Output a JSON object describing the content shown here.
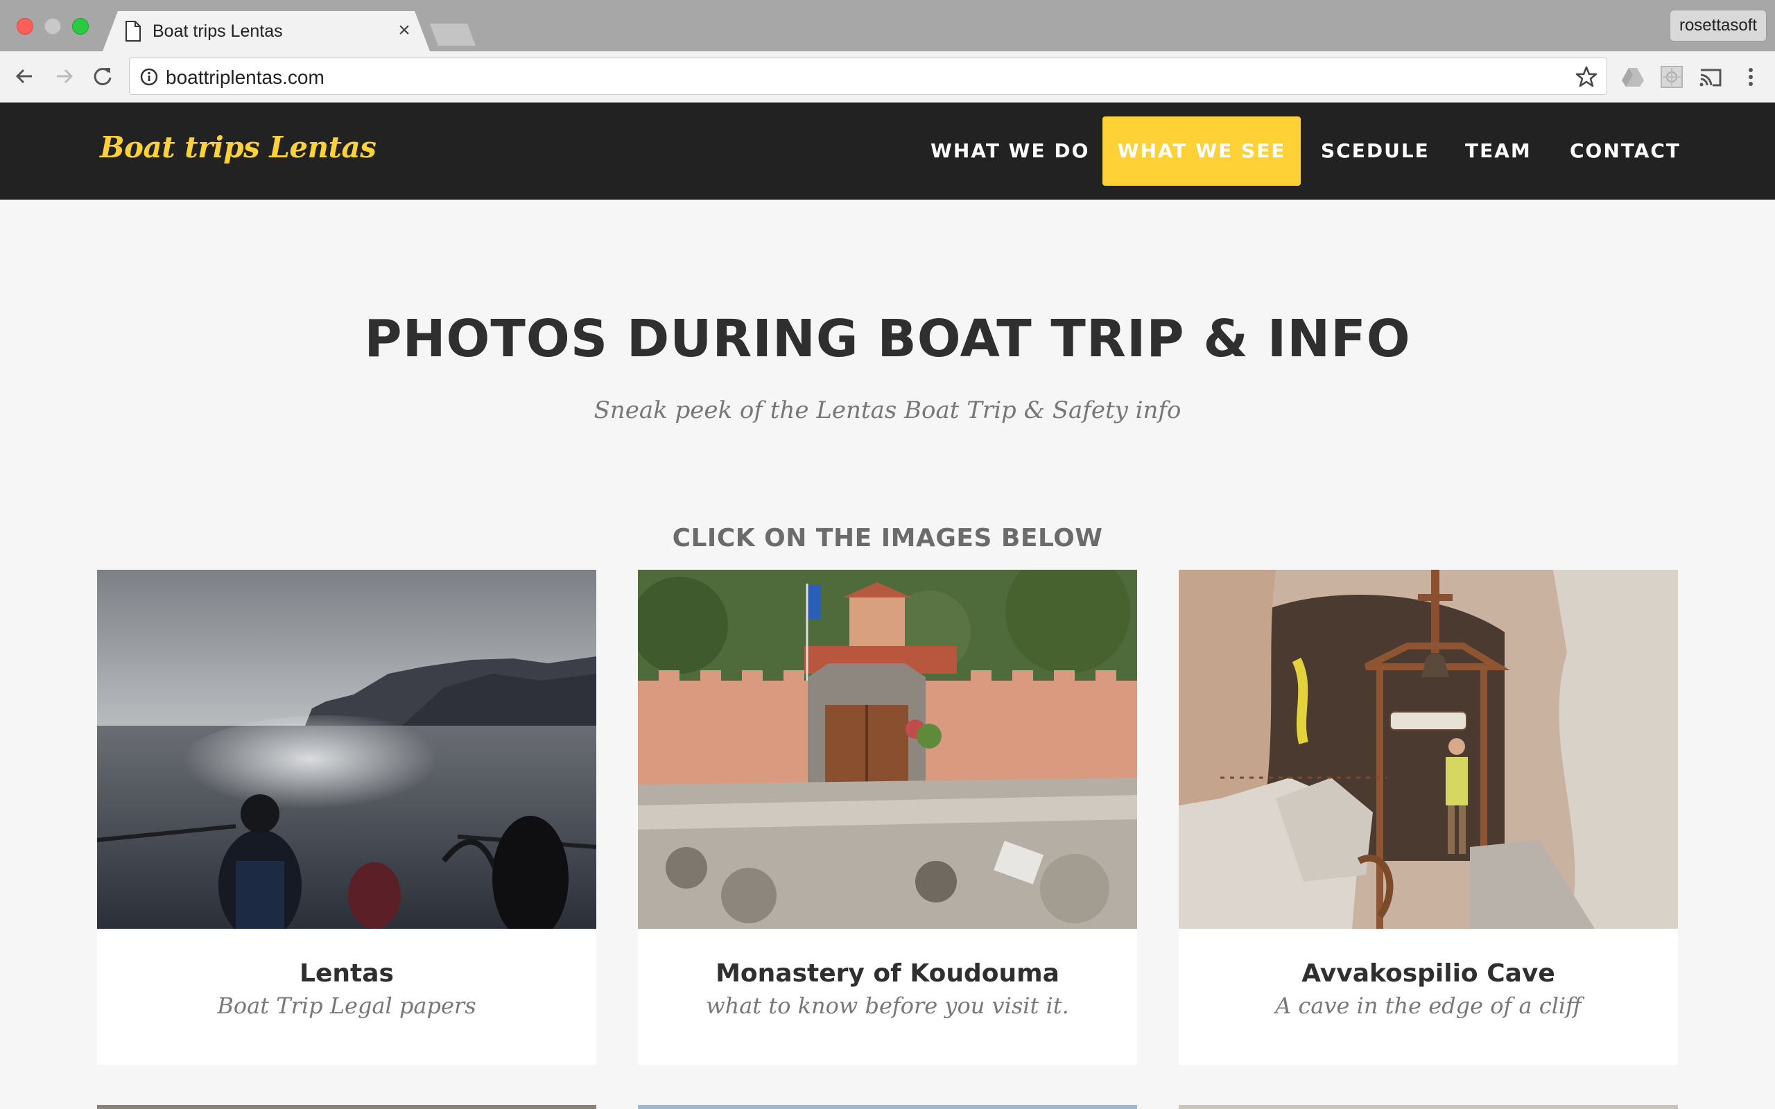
{
  "browser": {
    "tab_title": "Boat trips Lentas",
    "tab_close": "×",
    "url": "boattriplentas.com",
    "profile": "rosettasoft"
  },
  "site": {
    "brand": "Boat trips Lentas",
    "accent_color": "#fed136",
    "nav": [
      {
        "label": "WHAT WE DO",
        "active": false
      },
      {
        "label": "WHAT WE SEE",
        "active": true
      },
      {
        "label": "SCEDULE",
        "active": false
      },
      {
        "label": "TEAM",
        "active": false
      },
      {
        "label": "CONTACT",
        "active": false
      }
    ]
  },
  "main": {
    "heading": "PHOTOS DURING BOAT TRIP & INFO",
    "subheading": "Sneak peek of the Lentas Boat Trip & Safety info",
    "click_note": "CLICK ON THE IMAGES BELOW",
    "cards": [
      {
        "title": "Lentas",
        "subtitle": "Boat Trip Legal papers",
        "image": "sea-view-from-boat"
      },
      {
        "title": "Monastery of Koudouma",
        "subtitle": "what to know before you visit it.",
        "image": "monastery-wall-and-gate"
      },
      {
        "title": "Avvakospilio Cave",
        "subtitle": "A cave in the edge of a cliff",
        "image": "cave-with-wooden-bell-frame"
      }
    ]
  }
}
